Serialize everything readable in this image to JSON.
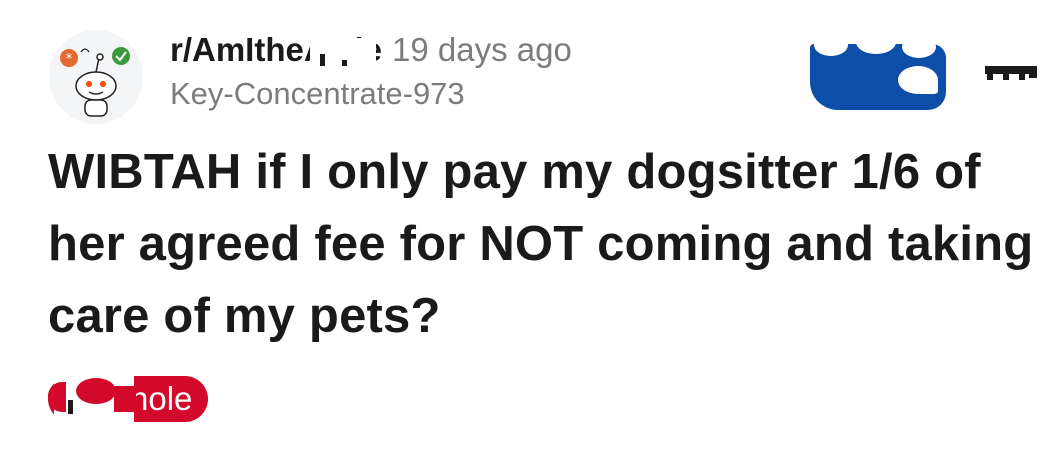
{
  "post": {
    "subreddit": "r/AmItheA ole",
    "age": "19 days ago",
    "author": "Key-Concentrate-973",
    "title": "WIBTAH if I only pay my dogsitter 1/6 of her agreed fee for NOT coming and taking care of my pets?",
    "flair": "hole"
  },
  "icons": {
    "avatar": "reddit-snoo-avatar-icon",
    "banner": "community-banner-icon",
    "award": "award-icon"
  },
  "colors": {
    "flair_bg": "#d2092a",
    "banner_blue": "#0c4ea8",
    "meta_gray": "#7c7c7c",
    "text": "#1a1a1b"
  }
}
